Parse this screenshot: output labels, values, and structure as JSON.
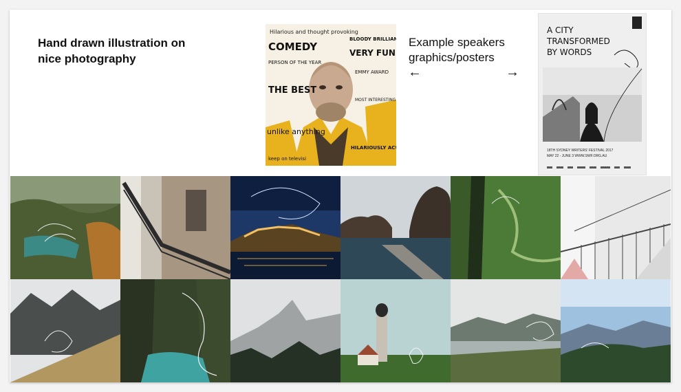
{
  "heading": {
    "line1": "Hand drawn illustration on",
    "line2": "nice photography"
  },
  "example": {
    "line1": "Example speakers",
    "line2": "graphics/posters",
    "arrow_left": "←",
    "arrow_right": "→"
  },
  "poster_comedy": {
    "lines": [
      "Hilarious and thought provoking",
      "COMEDY",
      "VERY FUNNY",
      "PERSON OF THE YEAR",
      "EMMY AWARD",
      "THE BEST",
      "unlike anything",
      "HILARIOUSLY ACUTE",
      "BLOODY BRILLIANT",
      "MOST INTERESTING",
      "keep on televisi"
    ]
  },
  "poster_city": {
    "title_lines": [
      "A CITY",
      "TRANSFORMED",
      "BY WORDS"
    ],
    "footer_line1": "18TH SYDNEY WRITERS' FESTIVAL 2017",
    "footer_line2": "MAY 22 - JUNE 3  WWW.SWF.ORG.AU"
  },
  "gallery": {
    "tiles": [
      "waterfall-lakes",
      "stair-tower",
      "night-castle",
      "sea-rocks",
      "mossy-cliff",
      "white-staircase",
      "mountain-ridge",
      "canyon-river",
      "misty-peaks",
      "church-tower",
      "foggy-lake",
      "valley-hills"
    ]
  }
}
